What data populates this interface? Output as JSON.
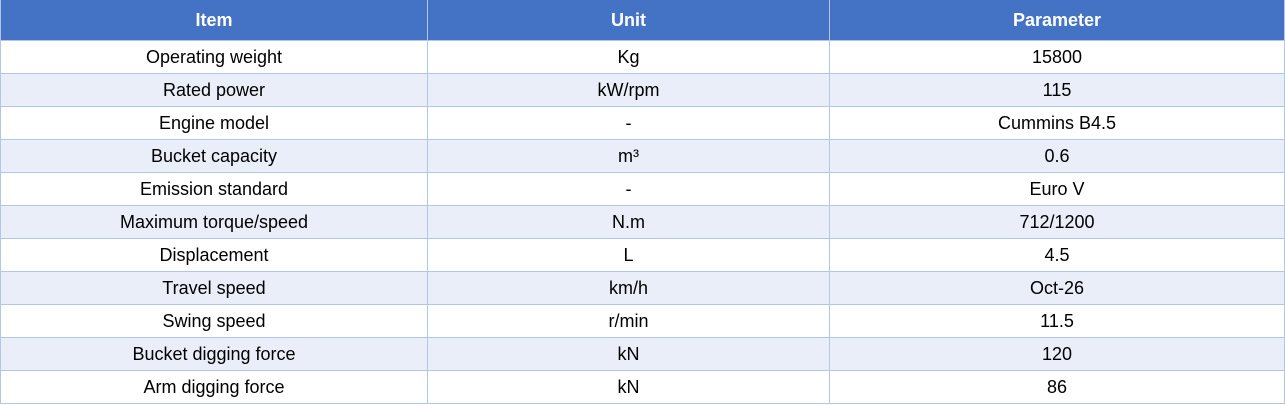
{
  "table": {
    "headers": [
      "Item",
      "Unit",
      "Parameter"
    ],
    "rows": [
      [
        "Operating weight",
        "Kg",
        "15800"
      ],
      [
        "Rated power",
        "kW/rpm",
        "115"
      ],
      [
        "Engine model",
        "-",
        "Cummins B4.5"
      ],
      [
        "Bucket capacity",
        "m³",
        "0.6"
      ],
      [
        "Emission standard",
        "-",
        "Euro V"
      ],
      [
        "Maximum torque/speed",
        "N.m",
        "712/1200"
      ],
      [
        "Displacement",
        "L",
        "4.5"
      ],
      [
        "Travel speed",
        "km/h",
        "Oct-26"
      ],
      [
        "Swing speed",
        "r/min",
        "11.5"
      ],
      [
        "Bucket digging force",
        "kN",
        "120"
      ],
      [
        "Arm digging force",
        "kN",
        "86"
      ]
    ]
  },
  "colors": {
    "header_bg": "#4472c4",
    "header_text": "#ffffff",
    "row_stripe": "#e9eef8",
    "border": "#b4c6e7"
  }
}
